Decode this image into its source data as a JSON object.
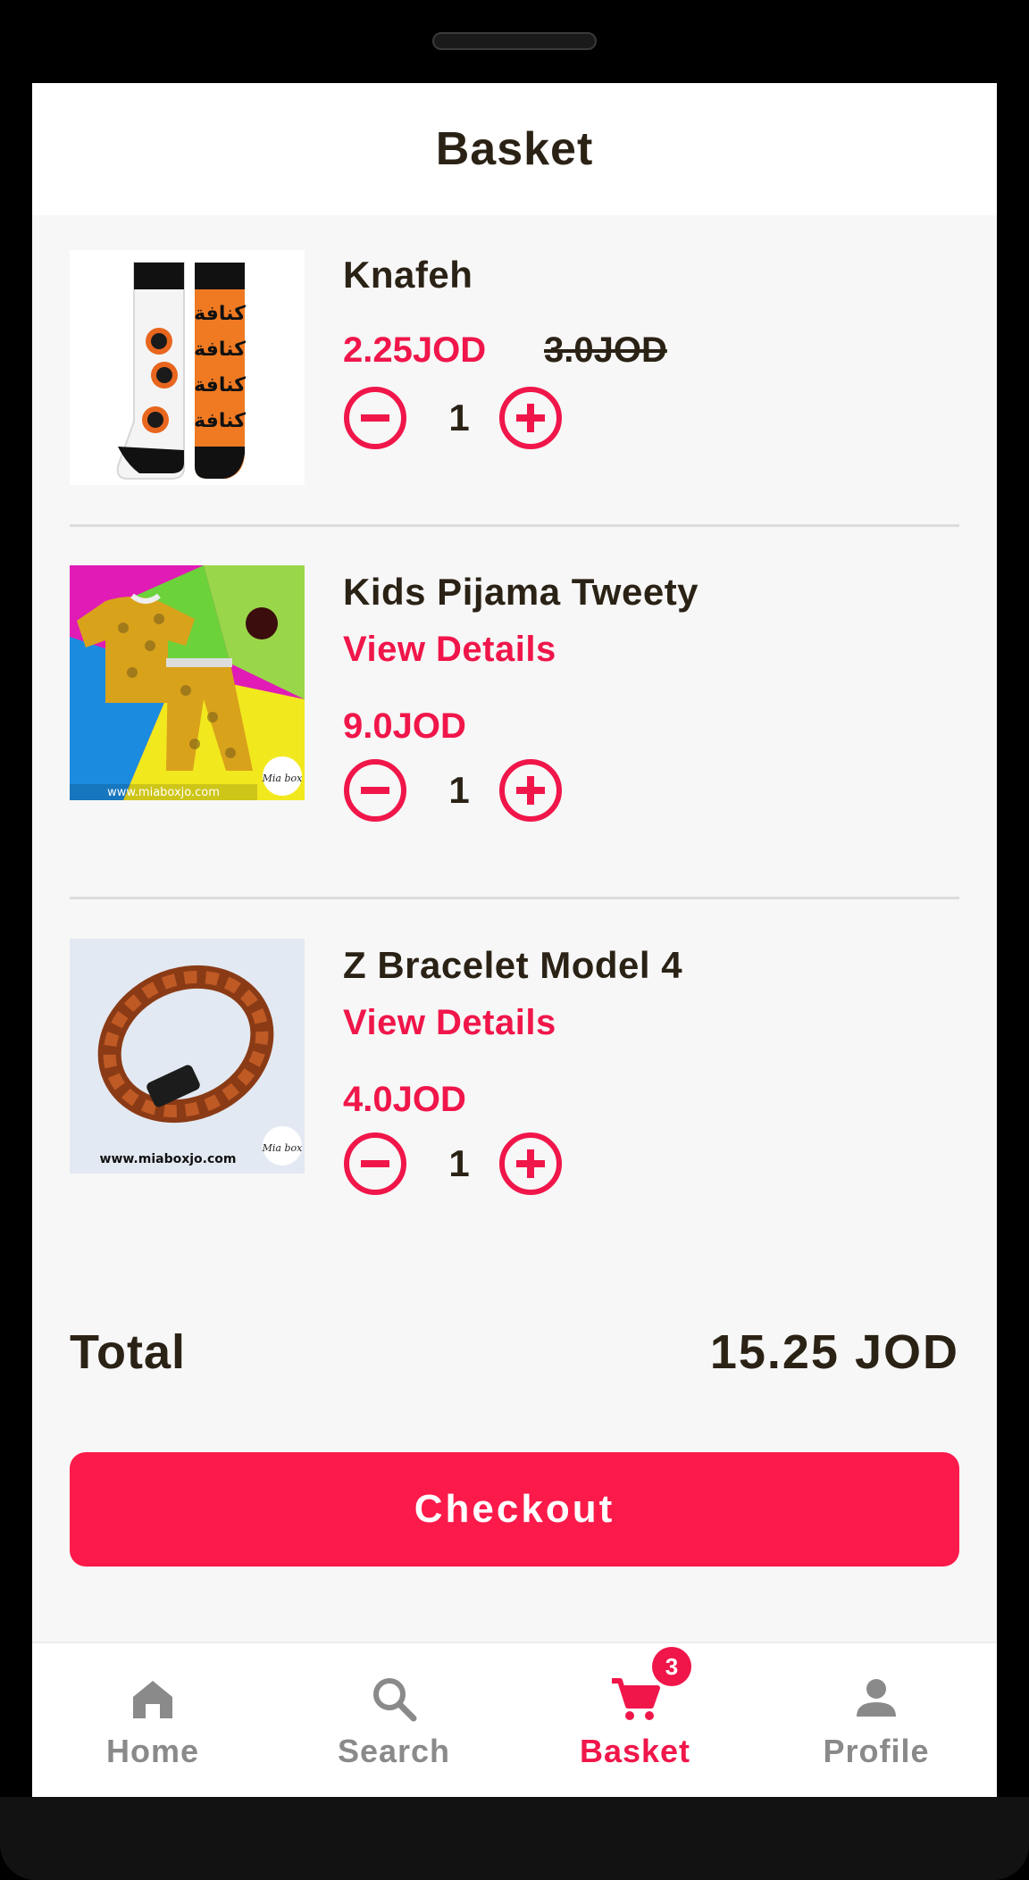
{
  "header": {
    "title": "Basket"
  },
  "items": [
    {
      "name": "Knafeh",
      "details_label": "",
      "price": "2.25JOD",
      "old_price": "3.0JOD",
      "quantity": "1",
      "image": {
        "icon": "socks-image",
        "text": "كنافة"
      }
    },
    {
      "name": "Kids Pijama Tweety",
      "details_label": "View Details",
      "price": "9.0JOD",
      "old_price": "",
      "quantity": "1",
      "image": {
        "icon": "pajama-image",
        "watermark": "www.miaboxjo.com",
        "logo_text": "Mia box"
      }
    },
    {
      "name": "Z Bracelet Model 4",
      "details_label": "View Details",
      "price": "4.0JOD",
      "old_price": "",
      "quantity": "1",
      "image": {
        "icon": "bracelet-image",
        "watermark": "www.miaboxjo.com",
        "logo_text": "Mia box"
      }
    }
  ],
  "summary": {
    "total_label": "Total",
    "total_value": "15.25 JOD"
  },
  "checkout": {
    "label": "Checkout"
  },
  "tabbar": {
    "tabs": [
      {
        "label": "Home",
        "icon": "home-icon"
      },
      {
        "label": "Search",
        "icon": "search-icon"
      },
      {
        "label": "Basket",
        "icon": "cart-icon",
        "badge": "3"
      },
      {
        "label": "Profile",
        "icon": "person-icon"
      }
    ],
    "active": "Basket"
  },
  "colors": {
    "accent": "#f0164a",
    "button": "#fc1a4a",
    "text": "#2b2216",
    "inactive": "#8a8a8a",
    "background": "#f7f7f7"
  }
}
